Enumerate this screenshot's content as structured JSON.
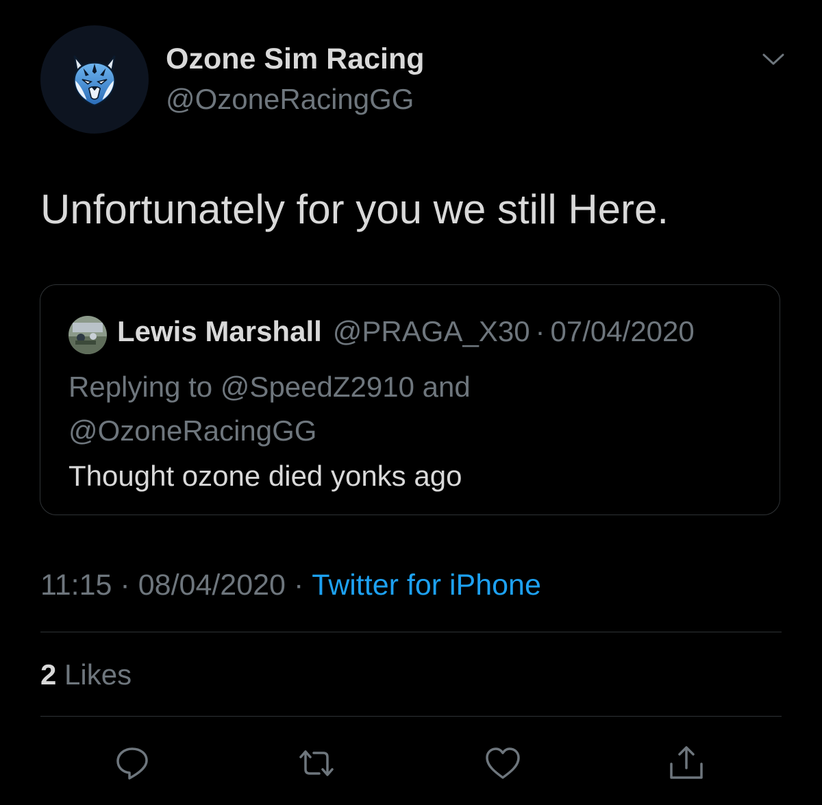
{
  "tweet": {
    "author": {
      "display_name": "Ozone Sim Racing",
      "handle": "@OzoneRacingGG",
      "avatar_icon": "tiger-logo-icon"
    },
    "more_icon": "chevron-down-icon",
    "text": "Unfortunately for you we still Here.",
    "quoted": {
      "author_name": "Lewis Marshall",
      "author_handle": "@PRAGA_X30",
      "separator": "·",
      "date": "07/04/2020",
      "reply_context": "Replying to @SpeedZ2910 and @OzoneRacingGG",
      "text": "Thought ozone died yonks ago"
    },
    "meta": {
      "time": "11:15",
      "separator": "·",
      "date": "08/04/2020",
      "source": "Twitter for iPhone"
    },
    "likes": {
      "count": "2",
      "label": "Likes"
    },
    "actions": [
      {
        "icon": "reply-icon"
      },
      {
        "icon": "retweet-icon"
      },
      {
        "icon": "like-icon"
      },
      {
        "icon": "share-icon"
      }
    ]
  },
  "colors": {
    "background": "#000000",
    "text_primary": "#d9d9d9",
    "text_secondary": "#6e767d",
    "link": "#1da1f2",
    "border": "#2f3336"
  }
}
